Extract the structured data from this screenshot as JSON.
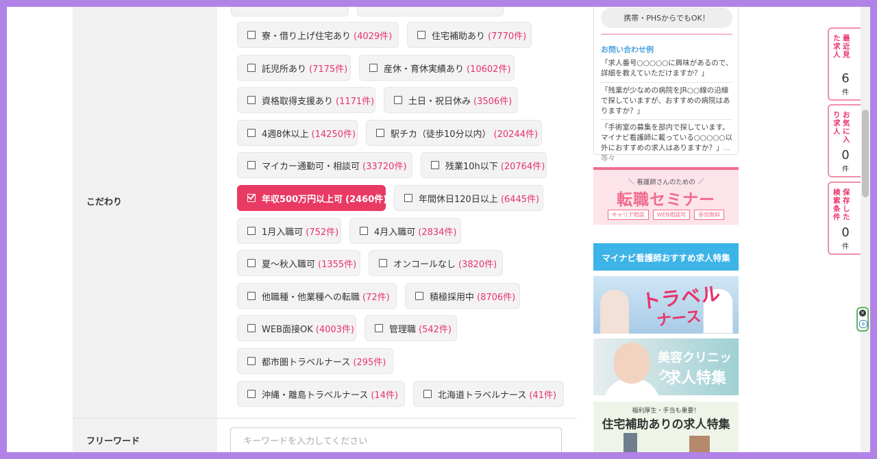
{
  "form": {
    "kodawari_label": "こだわり",
    "freeword_label": "フリーワード",
    "freeword_placeholder": "キーワードを入力してください"
  },
  "conditions": [
    {
      "label": "寮・借り上げ住宅あり",
      "count": "(4029件)",
      "checked": false
    },
    {
      "label": "住宅補助あり",
      "count": "(7770件)",
      "checked": false
    },
    {
      "label": "託児所あり",
      "count": "(7175件)",
      "checked": false
    },
    {
      "label": "産休・育休実績あり",
      "count": "(10602件)",
      "checked": false
    },
    {
      "label": "資格取得支援あり",
      "count": "(1171件)",
      "checked": false
    },
    {
      "label": "土日・祝日休み",
      "count": "(3506件)",
      "checked": false
    },
    {
      "label": "4週8休以上",
      "count": "(14250件)",
      "checked": false
    },
    {
      "label": "駅チカ（徒歩10分以内）",
      "count": "(20244件)",
      "checked": false
    },
    {
      "label": "マイカー通勤可・相談可",
      "count": "(33720件)",
      "checked": false
    },
    {
      "label": "残業10h以下",
      "count": "(20764件)",
      "checked": false
    },
    {
      "label": "年収500万円以上可",
      "count": "(2460件)",
      "checked": true
    },
    {
      "label": "年間休日120日以上",
      "count": "(6445件)",
      "checked": false
    },
    {
      "label": "1月入職可",
      "count": "(752件)",
      "checked": false
    },
    {
      "label": "4月入職可",
      "count": "(2834件)",
      "checked": false
    },
    {
      "label": "夏〜秋入職可",
      "count": "(1355件)",
      "checked": false
    },
    {
      "label": "オンコールなし",
      "count": "(3820件)",
      "checked": false
    },
    {
      "label": "他職種・他業種への転職",
      "count": "(72件)",
      "checked": false
    },
    {
      "label": "積極採用中",
      "count": "(8706件)",
      "checked": false
    },
    {
      "label": "WEB面接OK",
      "count": "(4003件)",
      "checked": false
    },
    {
      "label": "管理職",
      "count": "(542件)",
      "checked": false
    },
    {
      "label": "都市圏トラベルナース",
      "count": "(295件)",
      "checked": false
    },
    {
      "label": "沖縄・離島トラベルナース",
      "count": "(14件)",
      "checked": false
    },
    {
      "label": "北海道トラベルナース",
      "count": "(41件)",
      "checked": false
    }
  ],
  "contact": {
    "phs_note": "携帯・PHSからでもOK！",
    "examples_heading": "お問い合わせ例",
    "example1": "「求人番号○○○○○に興味があるので、詳細を教えていただけますか？」",
    "example2": "「残業が少なめの病院をJR○○線の沿線で探していますが、おすすめの病院はありますか？」",
    "example3": "「手術室の募集を部内で探しています。マイナビ看護師に載っている○○○○○以外におすすめの求人はありますか？」",
    "example3_more": "…等々"
  },
  "seminar": {
    "small": "＼ 看護師さんのための ／",
    "big": "転職セミナー",
    "tags": [
      "キャリア相談",
      "WEB相談可",
      "参加無料"
    ]
  },
  "feature_heading": "マイナビ看護師おすすめ求人特集",
  "banners": {
    "travel_title": "トラベル",
    "travel_sub": "ナース",
    "beauty_line1": "美容クリニック",
    "beauty_line2": "求人特集",
    "housing_small": "福利厚生・手当も重要！",
    "housing_big": "住宅補助ありの求人特集"
  },
  "side_tabs": [
    {
      "label": "最近見た求人",
      "count": "6",
      "unit": "件"
    },
    {
      "label": "お気に入り求人",
      "count": "0",
      "unit": "件"
    },
    {
      "label": "保存した検索条件",
      "count": "0",
      "unit": "件"
    }
  ],
  "colors": {
    "accent_pink": "#e93a63",
    "count_pink": "#e8336b",
    "feature_blue": "#3cb4e8",
    "frame_purple": "#b283e6"
  }
}
